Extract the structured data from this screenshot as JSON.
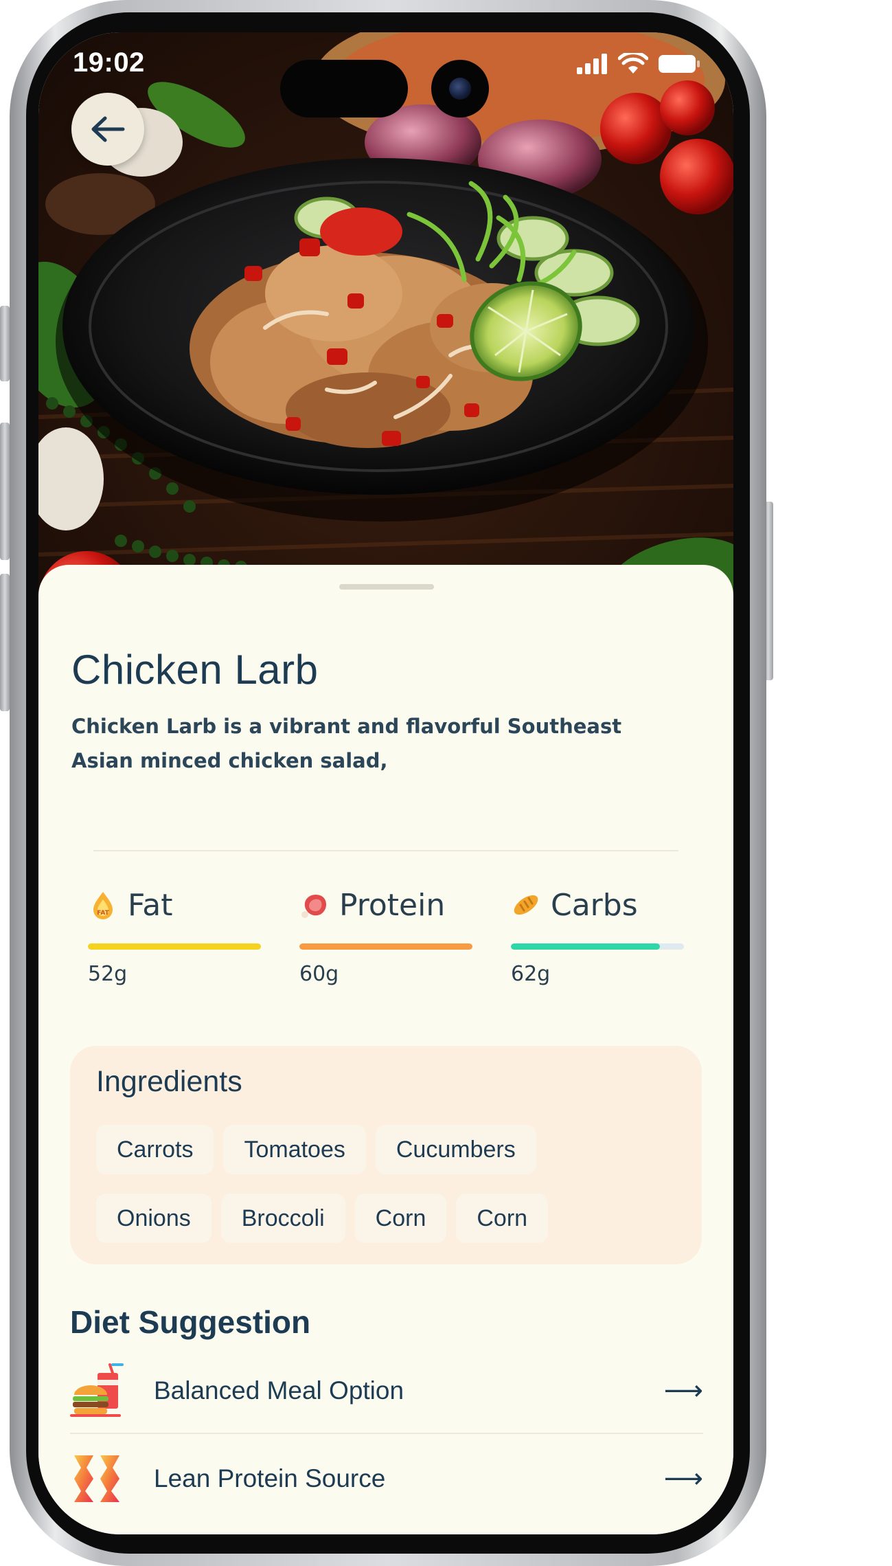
{
  "status_bar": {
    "time": "19:02"
  },
  "recipe": {
    "title": "Chicken Larb",
    "description": "Chicken Larb is a vibrant and flavorful Southeast Asian minced chicken salad,"
  },
  "macros": [
    {
      "label": "Fat",
      "amount": "52g",
      "fill_fraction": 1.0,
      "color": "#f5d21e",
      "icon": "fat-icon"
    },
    {
      "label": "Protein",
      "amount": "60g",
      "fill_fraction": 1.0,
      "color": "#f79a42",
      "icon": "meat-icon"
    },
    {
      "label": "Carbs",
      "amount": "62g",
      "fill_fraction": 0.86,
      "color": "#2ed6a8",
      "icon": "bread-icon"
    }
  ],
  "ingredients": {
    "title": "Ingredients",
    "items": [
      "Carrots",
      "Tomatoes",
      "Cucumbers",
      "Onions",
      "Broccoli",
      "Corn",
      "Corn"
    ]
  },
  "diet": {
    "title": "Diet Suggestion",
    "items": [
      {
        "label": "Balanced Meal Option",
        "icon": "fast-food-icon"
      },
      {
        "label": "Lean Protein Source",
        "icon": "protein-icon"
      }
    ]
  },
  "colors": {
    "sheet_bg": "#fcfbef",
    "text_primary": "#1d3b52",
    "ingredients_bg": "#fdefdf"
  }
}
